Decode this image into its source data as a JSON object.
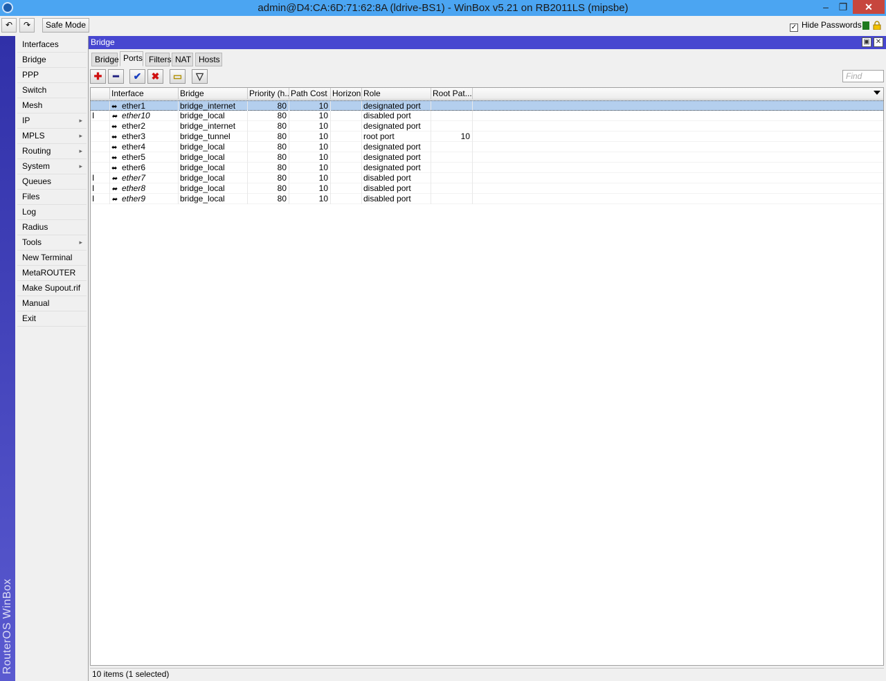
{
  "titlebar": {
    "title": "admin@D4:CA:6D:71:62:8A (ldrive-BS1) - WinBox v5.21 on RB2011LS (mipsbe)",
    "min": "–",
    "max": "❐",
    "close": "✕"
  },
  "toolbar": {
    "undo": "↶",
    "redo": "↷",
    "safe_mode": "Safe Mode",
    "hide_passwords": "Hide Passwords",
    "hide_passwords_checked": "✓"
  },
  "strip_text": "RouterOS WinBox",
  "menu": [
    {
      "label": "Interfaces",
      "arrow": ""
    },
    {
      "label": "Bridge",
      "arrow": ""
    },
    {
      "label": "PPP",
      "arrow": ""
    },
    {
      "label": "Switch",
      "arrow": ""
    },
    {
      "label": "Mesh",
      "arrow": ""
    },
    {
      "label": "IP",
      "arrow": "▸"
    },
    {
      "label": "MPLS",
      "arrow": "▸"
    },
    {
      "label": "Routing",
      "arrow": "▸"
    },
    {
      "label": "System",
      "arrow": "▸"
    },
    {
      "label": "Queues",
      "arrow": ""
    },
    {
      "label": "Files",
      "arrow": ""
    },
    {
      "label": "Log",
      "arrow": ""
    },
    {
      "label": "Radius",
      "arrow": ""
    },
    {
      "label": "Tools",
      "arrow": "▸"
    },
    {
      "label": "New Terminal",
      "arrow": ""
    },
    {
      "label": "MetaROUTER",
      "arrow": ""
    },
    {
      "label": "Make Supout.rif",
      "arrow": ""
    },
    {
      "label": "Manual",
      "arrow": ""
    },
    {
      "label": "Exit",
      "arrow": ""
    }
  ],
  "window": {
    "title": "Bridge",
    "restore": "▣",
    "close": "✕",
    "tabs": [
      "Bridge",
      "Ports",
      "Filters",
      "NAT",
      "Hosts"
    ],
    "active_tab": "Ports",
    "actions": {
      "add": "✚",
      "remove": "━",
      "enable": "✔",
      "disable": "✖",
      "comment": "▭",
      "filter": "▽"
    },
    "find_placeholder": "Find",
    "columns": [
      "",
      "Interface",
      "Bridge",
      "Priority (h...",
      "Path Cost",
      "Horizon",
      "Role",
      "Root Pat..."
    ],
    "rows": [
      {
        "flag": "",
        "interface": "ether1",
        "bridge": "bridge_internet",
        "priority": "80",
        "path_cost": "10",
        "horizon": "",
        "role": "designated port",
        "root_path": "",
        "disabled": false,
        "selected": true
      },
      {
        "flag": "I",
        "interface": "ether10",
        "bridge": "bridge_local",
        "priority": "80",
        "path_cost": "10",
        "horizon": "",
        "role": "disabled port",
        "root_path": "",
        "disabled": true,
        "selected": false
      },
      {
        "flag": "",
        "interface": "ether2",
        "bridge": "bridge_internet",
        "priority": "80",
        "path_cost": "10",
        "horizon": "",
        "role": "designated port",
        "root_path": "",
        "disabled": false,
        "selected": false
      },
      {
        "flag": "",
        "interface": "ether3",
        "bridge": "bridge_tunnel",
        "priority": "80",
        "path_cost": "10",
        "horizon": "",
        "role": "root port",
        "root_path": "10",
        "disabled": false,
        "selected": false
      },
      {
        "flag": "",
        "interface": "ether4",
        "bridge": "bridge_local",
        "priority": "80",
        "path_cost": "10",
        "horizon": "",
        "role": "designated port",
        "root_path": "",
        "disabled": false,
        "selected": false
      },
      {
        "flag": "",
        "interface": "ether5",
        "bridge": "bridge_local",
        "priority": "80",
        "path_cost": "10",
        "horizon": "",
        "role": "designated port",
        "root_path": "",
        "disabled": false,
        "selected": false
      },
      {
        "flag": "",
        "interface": "ether6",
        "bridge": "bridge_local",
        "priority": "80",
        "path_cost": "10",
        "horizon": "",
        "role": "designated port",
        "root_path": "",
        "disabled": false,
        "selected": false
      },
      {
        "flag": "I",
        "interface": "ether7",
        "bridge": "bridge_local",
        "priority": "80",
        "path_cost": "10",
        "horizon": "",
        "role": "disabled port",
        "root_path": "",
        "disabled": true,
        "selected": false
      },
      {
        "flag": "I",
        "interface": "ether8",
        "bridge": "bridge_local",
        "priority": "80",
        "path_cost": "10",
        "horizon": "",
        "role": "disabled port",
        "root_path": "",
        "disabled": true,
        "selected": false
      },
      {
        "flag": "I",
        "interface": "ether9",
        "bridge": "bridge_local",
        "priority": "80",
        "path_cost": "10",
        "horizon": "",
        "role": "disabled port",
        "root_path": "",
        "disabled": true,
        "selected": false
      }
    ],
    "port_icon": "⬌",
    "status": "10 items (1 selected)"
  }
}
